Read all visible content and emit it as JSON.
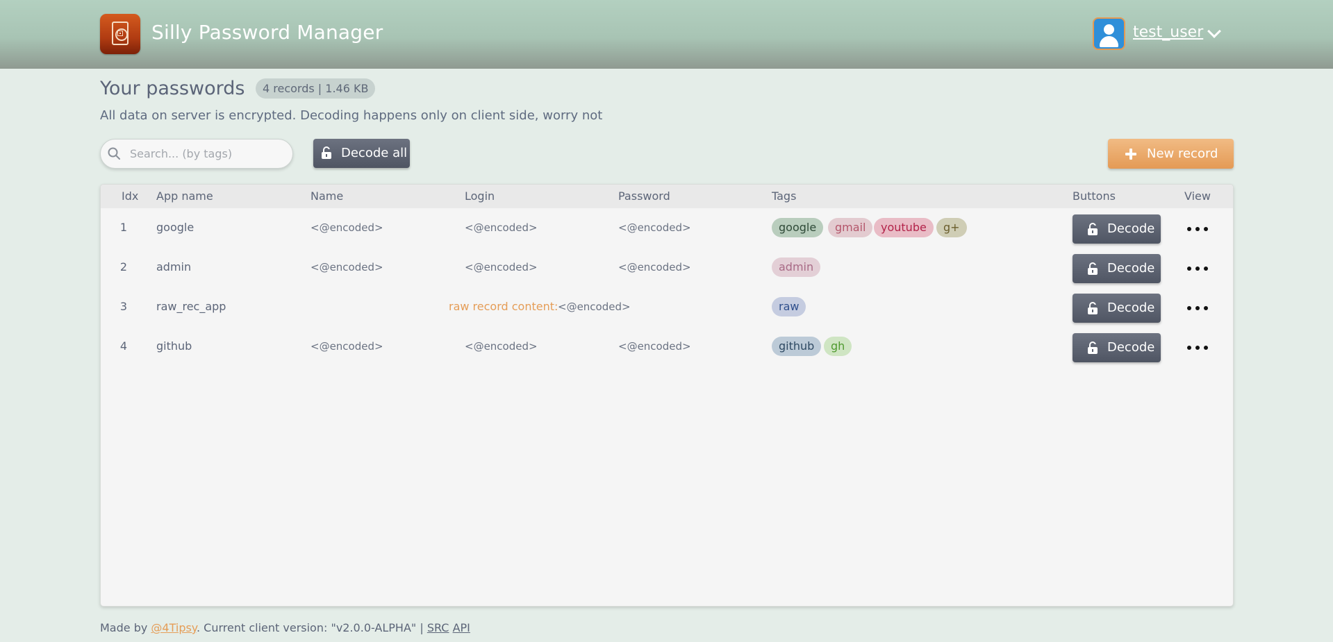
{
  "header": {
    "app_title": "Silly Password Manager",
    "username": "test_user",
    "logo_icon": "safe-icon",
    "avatar_icon": "user-icon",
    "dropdown_icon": "chevron-down-icon"
  },
  "page": {
    "title": "Your passwords",
    "records_badge": "4 records | 1.46 KB",
    "subtitle": "All data on server is encrypted. Decoding happens only on client side, worry not"
  },
  "toolbar": {
    "search_placeholder": "Search... (by tags)",
    "search_value": "",
    "decode_all_label": "Decode all",
    "new_record_label": "New record"
  },
  "table": {
    "headers": {
      "idx": "Idx",
      "app_name": "App name",
      "name": "Name",
      "login": "Login",
      "password": "Password",
      "tags": "Tags",
      "buttons": "Buttons",
      "view": "View"
    },
    "rows": [
      {
        "idx": "1",
        "app_name": "google",
        "name": "<@encoded>",
        "login": "<@encoded>",
        "password": "<@encoded>",
        "tags": [
          "google",
          "gmail",
          "youtube",
          "g+"
        ],
        "decode_label": "Decode"
      },
      {
        "idx": "2",
        "app_name": "admin",
        "name": "<@encoded>",
        "login": "<@encoded>",
        "password": "<@encoded>",
        "tags": [
          "admin"
        ],
        "decode_label": "Decode"
      },
      {
        "idx": "3",
        "app_name": "raw_rec_app",
        "raw_label": "raw record content:",
        "raw_value": "<@encoded>",
        "tags": [
          "raw"
        ],
        "decode_label": "Decode"
      },
      {
        "idx": "4",
        "app_name": "github",
        "name": "<@encoded>",
        "login": "<@encoded>",
        "password": "<@encoded>",
        "tags": [
          "github",
          "gh"
        ],
        "decode_label": "Decode"
      }
    ]
  },
  "footer": {
    "made_by": "Made by ",
    "author": "@4Tipsy",
    "version_text": ". Current client version: \"v2.0.0-ALPHA\" | ",
    "src_link": "SRC",
    "api_link": "API"
  },
  "colors": {
    "header_gradient_top": "#b3d0c0",
    "background": "#e4ede8",
    "accent_orange": "#e59d57",
    "button_dark": "#5a606e"
  }
}
